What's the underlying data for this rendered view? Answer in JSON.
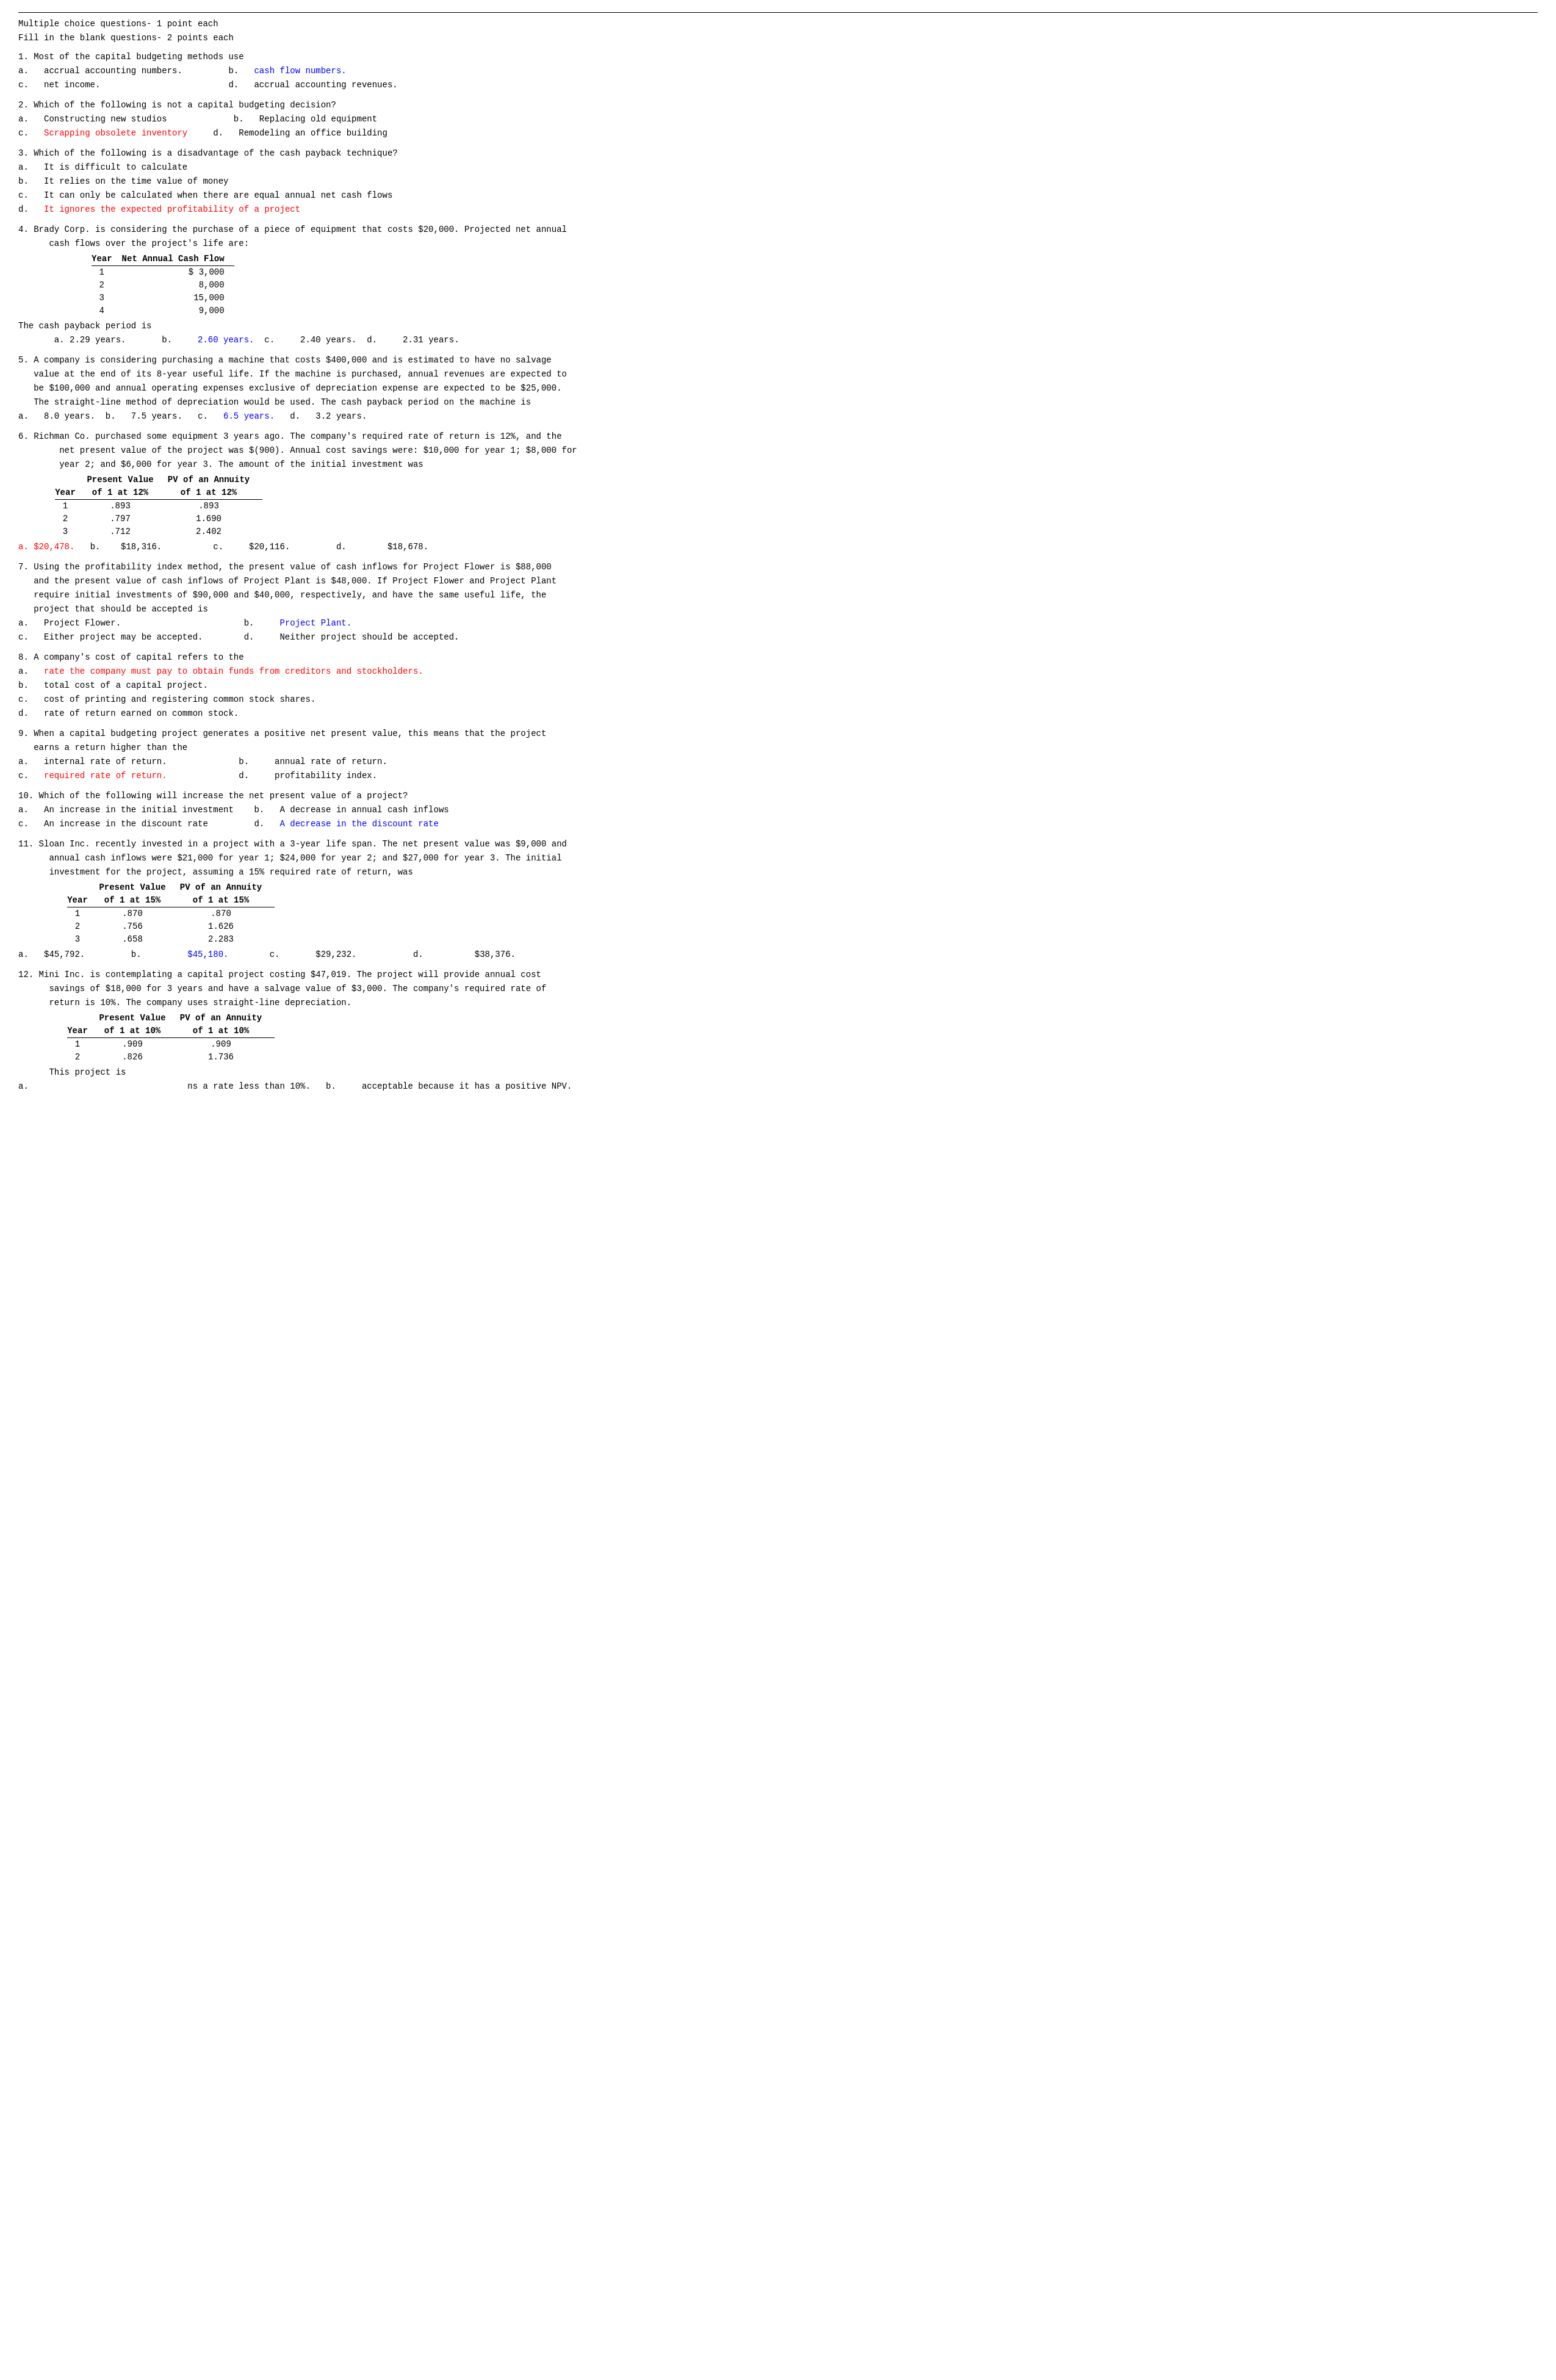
{
  "header": {
    "divider": true,
    "line1": "Multiple choice questions- 1 point each",
    "line2": "Fill in the blank questions- 2 points each"
  },
  "questions": [
    {
      "id": "q1",
      "text": "1. Most of the capital budgeting methods use",
      "answers": [
        {
          "label": "a.",
          "text": "accrual accounting numbers.",
          "suffix": "b.",
          "b_text": "cash flow numbers.",
          "b_class": "blue"
        },
        {
          "label": "c.",
          "text": "net income.",
          "suffix": "d.",
          "b_text": "accrual accounting revenues."
        }
      ]
    },
    {
      "id": "q2",
      "text": "2. Which of the following is not a capital budgeting decision?",
      "answers": [
        {
          "label": "a.",
          "text": "Constructing new studios",
          "suffix": "b.",
          "b_text": "Replacing old equipment"
        },
        {
          "label": "c.",
          "text": "Scrapping obsolete inventory",
          "c_class": "red",
          "suffix": "d.",
          "b_text": "Remodeling an office building"
        }
      ]
    },
    {
      "id": "q3",
      "text": "3. Which of the following is a disadvantage of the cash payback technique?",
      "answers_list": [
        {
          "label": "a.",
          "text": "It is difficult to calculate"
        },
        {
          "label": "b.",
          "text": "It relies on the time value of money"
        },
        {
          "label": "c.",
          "text": "It can only be calculated when there are equal annual net cash flows"
        },
        {
          "label": "d.",
          "text": "It ignores the expected profitability of a project",
          "class": "red"
        }
      ]
    },
    {
      "id": "q4",
      "text": "4. Brady Corp. is considering the purchase of a piece of equipment that costs $20,000. Projected net annual",
      "text2": "     cash flows over the project's life are:",
      "table": {
        "headers": [
          "Year",
          "Net Annual Cash Flow"
        ],
        "rows": [
          [
            "1",
            "$ 3,000"
          ],
          [
            "2",
            "8,000"
          ],
          [
            "3",
            "15,000"
          ],
          [
            "4",
            "9,000"
          ]
        ]
      },
      "payback": "The cash payback period is",
      "choices": [
        {
          "label": "a.",
          "text": "2.29 years.",
          "class": ""
        },
        {
          "label": "b.",
          "text": "2.60 years.",
          "class": "blue"
        },
        {
          "label": "c.",
          "text": "2.40 years.",
          "class": ""
        },
        {
          "label": "d.",
          "text": "2.31 years.",
          "class": ""
        }
      ]
    },
    {
      "id": "q5",
      "text": "5. A company is considering purchasing a machine that costs $400,000 and is estimated to have no salvage",
      "text2": "   value at the end of its 8-year useful life. If the machine is purchased, annual revenues are expected to",
      "text3": "   be $100,000 and annual operating expenses exclusive of depreciation expense are expected to be $25,000.",
      "text4": "   The straight-line method of depreciation would be used. The cash payback period on the machine is",
      "choices": [
        {
          "label": "a.",
          "text": "8.0 years."
        },
        {
          "label": "b.",
          "text": "7.5 years."
        },
        {
          "label": "c.",
          "text": "6.5 years.",
          "class": "blue"
        },
        {
          "label": "d.",
          "text": "3.2 years."
        }
      ]
    },
    {
      "id": "q6",
      "text": "6. Richman Co. purchased some equipment 3 years ago. The company's required rate of return is 12%, and the",
      "text2": "        net present value of the project was $(900). Annual cost savings were: $10,000 for year 1; $8,000 for",
      "text3": "        year 2; and $6,000 for year 3. The amount of the initial investment was",
      "table": {
        "headers": [
          "Year",
          "Present Value\nof 1 at 12%",
          "PV of an Annuity\nof 1 at 12%"
        ],
        "rows": [
          [
            "1",
            ".893",
            ".893"
          ],
          [
            "2",
            ".797",
            "1.690"
          ],
          [
            "3",
            ".712",
            "2.402"
          ]
        ]
      },
      "choices": [
        {
          "label": "a.",
          "text": "$20,478.",
          "class": "red"
        },
        {
          "label": "b.",
          "text": "$18,316.",
          "class": ""
        },
        {
          "label": "c.",
          "text": "$20,116.",
          "class": ""
        },
        {
          "label": "d.",
          "text": "$18,678.",
          "class": ""
        }
      ]
    },
    {
      "id": "q7",
      "text": "7. Using the profitability index method, the present value of cash inflows for Project Flower is $88,000",
      "text2": "   and the present value of cash inflows of Project Plant is $48,000. If Project Flower and Project Plant",
      "text3": "   require initial investments of $90,000 and $40,000, respectively, and have the same useful life, the",
      "text4": "   project that should be accepted is",
      "answers": [
        {
          "label": "a.",
          "text": "Project Flower.",
          "suffix": "b.",
          "b_text": "Project Plant.",
          "b_class": "blue"
        },
        {
          "label": "c.",
          "text": "Either project may be accepted.",
          "suffix": "d.",
          "b_text": "Neither project should be accepted."
        }
      ]
    },
    {
      "id": "q8",
      "text": "8. A company's cost of capital refers to the",
      "answers_list": [
        {
          "label": "a.",
          "text": "rate the company must pay to obtain funds from creditors and stockholders.",
          "class": "red"
        },
        {
          "label": "b.",
          "text": "total cost of a capital project."
        },
        {
          "label": "c.",
          "text": "cost of printing and registering common stock shares."
        },
        {
          "label": "d.",
          "text": "rate of return earned on common stock."
        }
      ]
    },
    {
      "id": "q9",
      "text": "9. When a capital budgeting project generates a positive net present value, this means that the project",
      "text2": "   earns a return higher than the",
      "answers": [
        {
          "label": "a.",
          "text": "internal rate of return.",
          "suffix": "b.",
          "b_text": "annual rate of return."
        },
        {
          "label": "c.",
          "text": "required rate of return.",
          "c_class": "red",
          "suffix": "d.",
          "b_text": "profitability index."
        }
      ]
    },
    {
      "id": "q10",
      "text": "10. Which of the following will increase the net present value of a project?",
      "answers": [
        {
          "label": "a.",
          "text": "An increase in the initial investment",
          "suffix": "b.",
          "b_text": "A decrease in annual cash inflows"
        },
        {
          "label": "c.",
          "text": "An increase in the discount rate",
          "suffix": "d.",
          "b_text": "A decrease in the discount rate",
          "d_class": "blue"
        }
      ]
    },
    {
      "id": "q11",
      "text": "11. Sloan Inc. recently invested in a project with a 3-year life span. The net present value was $9,000 and",
      "text2": "     annual cash inflows were $21,000 for year 1; $24,000 for year 2; and $27,000 for year 3. The initial",
      "text3": "     investment for the project, assuming a 15% required rate of return, was",
      "table": {
        "headers": [
          "Year",
          "Present Value\nof 1 at 15%",
          "PV of an Annuity\nof 1 at 15%"
        ],
        "rows": [
          [
            "1",
            ".870",
            ".870"
          ],
          [
            "2",
            ".756",
            "1.626"
          ],
          [
            "3",
            ".658",
            "2.283"
          ]
        ]
      },
      "choices": [
        {
          "label": "a.",
          "text": "$45,792.",
          "class": ""
        },
        {
          "label": "b.",
          "text": "$45,180.",
          "class": "blue"
        },
        {
          "label": "c.",
          "text": "$29,232.",
          "class": ""
        },
        {
          "label": "d.",
          "text": "$38,376.",
          "class": ""
        }
      ]
    },
    {
      "id": "q12",
      "text": "12. Mini Inc. is contemplating a capital project costing $47,019. The project will provide annual cost",
      "text2": "     savings of $18,000 for 3 years and have a salvage value of $3,000. The company's required rate of",
      "text3": "     return is 10%. The company uses straight-line depreciation.",
      "table": {
        "headers": [
          "Year",
          "Present Value\nof 1 at 10%",
          "PV of an Annuity\nof 1 at 10%"
        ],
        "rows": [
          [
            "1",
            ".909",
            ".909"
          ],
          [
            "2",
            ".826",
            "1.736"
          ]
        ]
      },
      "payback": "This project is",
      "choices": [
        {
          "label": "a.",
          "text": "ns a rate less than 10%.  b.",
          "class": "",
          "suffix": "",
          "b_text": "acceptable because it has a positive NPV.",
          "b_class": ""
        }
      ]
    }
  ]
}
